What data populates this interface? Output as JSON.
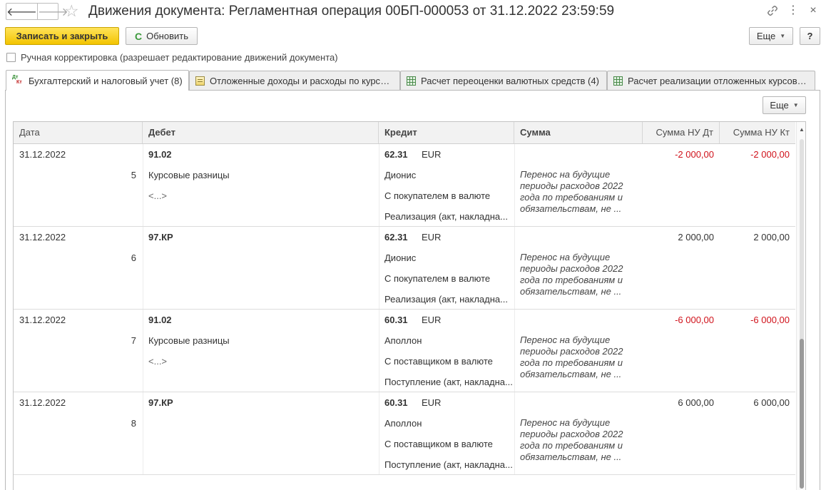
{
  "window": {
    "title": "Движения документа: Регламентная операция 00БП-000053 от 31.12.2022 23:59:59",
    "back_glyph": "🡐",
    "forward_glyph": "🡒",
    "star_glyph": "☆",
    "more_glyph": "⋮",
    "close_glyph": "×"
  },
  "toolbar": {
    "save_close_label": "Записать и закрыть",
    "refresh_label": "Обновить",
    "refresh_glyph": "C",
    "more_label": "Еще",
    "help_label": "?"
  },
  "manual_correction": {
    "label": "Ручная корректировка (разрешает редактирование движений документа)",
    "checked": false
  },
  "tabs": [
    {
      "label": "Бухгалтерский и налоговый учет (8)",
      "icon": "dt-kt-icon",
      "active": true
    },
    {
      "label": "Отложенные доходы и расходы по курсовым разницам",
      "icon": "document-icon",
      "active": false
    },
    {
      "label": "Расчет переоценки валютных средств (4)",
      "icon": "table-icon",
      "active": false
    },
    {
      "label": "Расчет реализации отложенных курсовых разниц",
      "icon": "table-icon",
      "active": false
    }
  ],
  "panel": {
    "more_label": "Еще"
  },
  "table": {
    "columns": {
      "date": "Дата",
      "debit": "Дебет",
      "credit": "Кредит",
      "sum": "Сумма",
      "sum_nu_dt": "Сумма НУ Дт",
      "sum_nu_kt": "Сумма НУ Кт"
    },
    "rows": [
      {
        "date": "31.12.2022",
        "num": "5",
        "debit_account": "91.02",
        "debit_sub1": "Курсовые разницы",
        "debit_sub2": "<...>",
        "credit_account": "62.31",
        "currency": "EUR",
        "credit_sub1": "Дионис",
        "credit_sub2": "С покупателем в валюте",
        "credit_sub3": "Реализация (акт, накладна...",
        "comment": "Перенос на будущие периоды расходов 2022 года по требованиям и обязательствам, не ...",
        "sum_nu_dt": "-2 000,00",
        "sum_nu_kt": "-2 000,00",
        "negative": true
      },
      {
        "date": "31.12.2022",
        "num": "6",
        "debit_account": "97.КР",
        "debit_sub1": "",
        "debit_sub2": "",
        "credit_account": "62.31",
        "currency": "EUR",
        "credit_sub1": "Дионис",
        "credit_sub2": "С покупателем в валюте",
        "credit_sub3": "Реализация (акт, накладна...",
        "comment": "Перенос на будущие периоды расходов 2022 года по требованиям и обязательствам, не ...",
        "sum_nu_dt": "2 000,00",
        "sum_nu_kt": "2 000,00",
        "negative": false
      },
      {
        "date": "31.12.2022",
        "num": "7",
        "debit_account": "91.02",
        "debit_sub1": "Курсовые разницы",
        "debit_sub2": "<...>",
        "credit_account": "60.31",
        "currency": "EUR",
        "credit_sub1": "Аполлон",
        "credit_sub2": "С поставщиком в валюте",
        "credit_sub3": "Поступление (акт, накладна...",
        "comment": "Перенос на будущие периоды расходов 2022 года по требованиям и обязательствам, не ...",
        "sum_nu_dt": "-6 000,00",
        "sum_nu_kt": "-6 000,00",
        "negative": true
      },
      {
        "date": "31.12.2022",
        "num": "8",
        "debit_account": "97.КР",
        "debit_sub1": "",
        "debit_sub2": "",
        "credit_account": "60.31",
        "currency": "EUR",
        "credit_sub1": "Аполлон",
        "credit_sub2": "С поставщиком в валюте",
        "credit_sub3": "Поступление (акт, накладна...",
        "comment": "Перенос на будущие периоды расходов 2022 года по требованиям и обязательствам, не ...",
        "sum_nu_dt": "6 000,00",
        "sum_nu_kt": "6 000,00",
        "negative": false
      }
    ]
  },
  "colors": {
    "primary_button": "#f3c400",
    "negative_amount": "#d0121b",
    "header_bg": "#f2f2f2"
  }
}
